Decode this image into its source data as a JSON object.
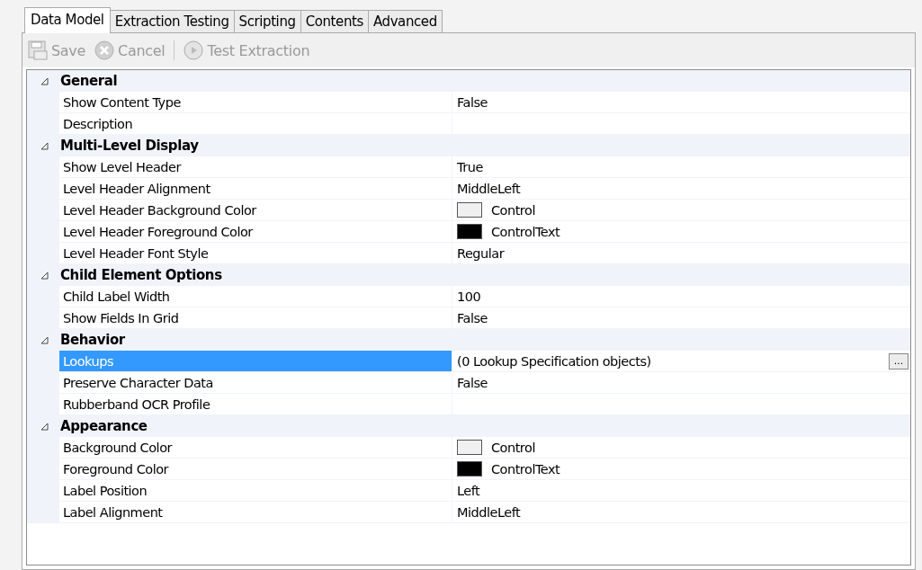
{
  "tabs": [
    {
      "label": "Data Model",
      "selected": true
    },
    {
      "label": "Extraction Testing",
      "selected": false
    },
    {
      "label": "Scripting",
      "selected": false
    },
    {
      "label": "Contents",
      "selected": false
    },
    {
      "label": "Advanced",
      "selected": false
    }
  ],
  "toolbar": [
    {
      "kind": "save",
      "label": "Save",
      "disabled": true
    },
    {
      "kind": "cancel",
      "label": "Cancel",
      "disabled": true
    },
    {
      "kind": "separator"
    },
    {
      "kind": "test",
      "label": "Test Extraction",
      "disabled": true
    }
  ],
  "property_grid": {
    "categories": [
      {
        "name": "General",
        "expanded": true,
        "properties": [
          {
            "name": "Show Content Type",
            "value": "False",
            "selected": false
          },
          {
            "name": "Description",
            "selected": false
          }
        ]
      },
      {
        "name": "Multi-Level Display",
        "expanded": true,
        "properties": [
          {
            "name": "Show Level Header",
            "value": "True",
            "selected": false
          },
          {
            "name": "Level Header Alignment",
            "value": "MiddleLeft",
            "selected": false
          },
          {
            "name": "Level Header Background Color",
            "value": "Control",
            "color": "#f0f0f0",
            "selected": false
          },
          {
            "name": "Level Header Foreground Color",
            "value": "ControlText",
            "color": "#000000",
            "selected": false
          },
          {
            "name": "Level Header Font Style",
            "value": "Regular",
            "selected": false
          }
        ]
      },
      {
        "name": "Child Element Options",
        "expanded": true,
        "properties": [
          {
            "name": "Child Label Width",
            "value": "100",
            "selected": false
          },
          {
            "name": "Show Fields In Grid",
            "value": "False",
            "selected": false
          }
        ]
      },
      {
        "name": "Behavior",
        "expanded": true,
        "properties": [
          {
            "name": "Lookups",
            "value": "(0 Lookup Specification objects)",
            "selected": true,
            "button": "..."
          },
          {
            "name": "Preserve Character Data",
            "value": "False",
            "selected": false
          },
          {
            "name": "Rubberband OCR Profile",
            "selected": false
          }
        ]
      },
      {
        "name": "Appearance",
        "expanded": true,
        "properties": [
          {
            "name": "Background Color",
            "value": "Control",
            "color": "#f0f0f0",
            "selected": false
          },
          {
            "name": "Foreground Color",
            "value": "ControlText",
            "color": "#000000",
            "selected": false
          },
          {
            "name": "Label Position",
            "value": "Left",
            "selected": false
          },
          {
            "name": "Label Alignment",
            "value": "MiddleLeft",
            "selected": false
          }
        ]
      }
    ]
  }
}
